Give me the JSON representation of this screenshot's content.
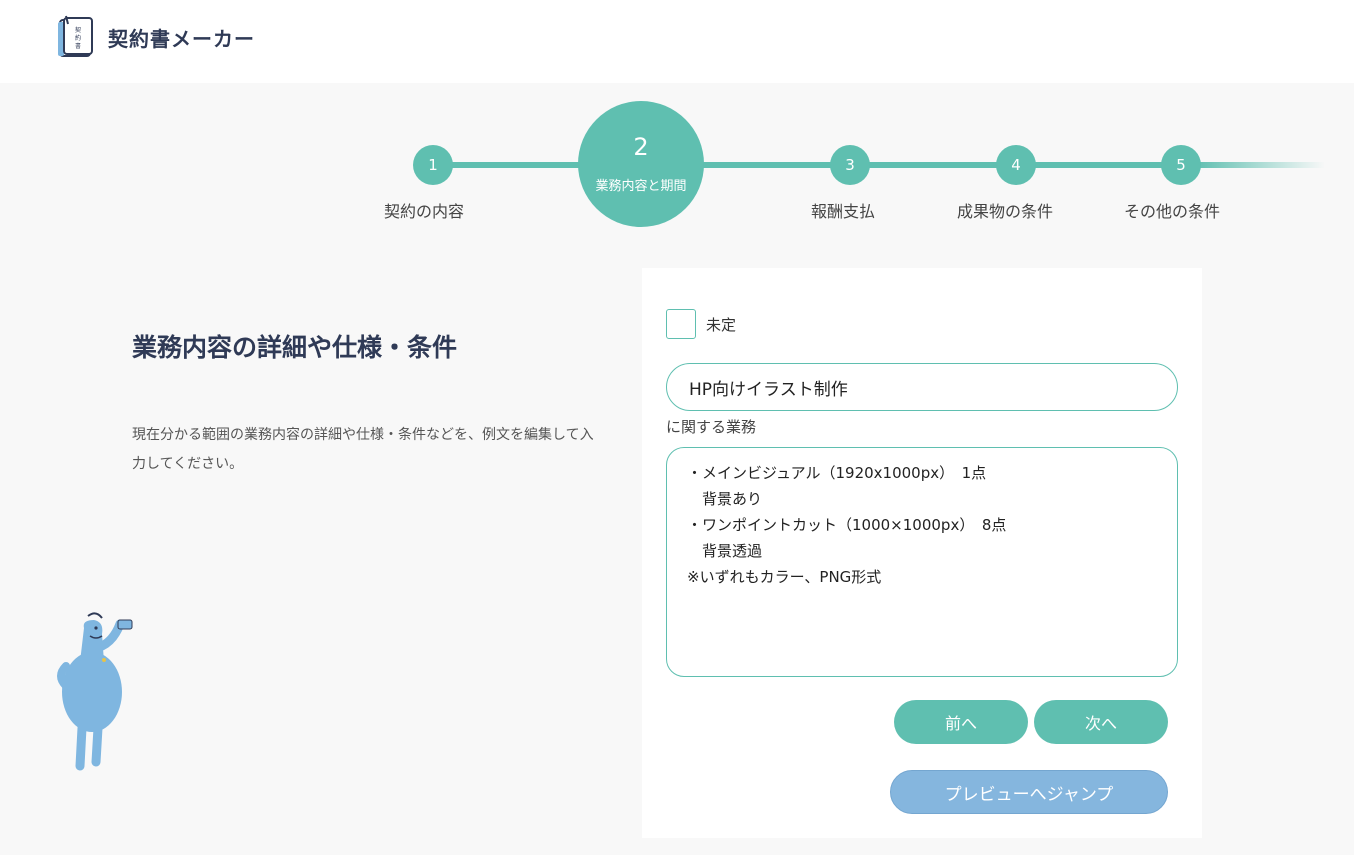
{
  "app": {
    "title": "契約書メーカー",
    "logo_icon": "contract-book-icon",
    "logo_badge": "契約書"
  },
  "stepper": {
    "active_index": 2,
    "steps": [
      {
        "number": "1",
        "label": "契約の内容"
      },
      {
        "number": "2",
        "label": "業務内容と期間"
      },
      {
        "number": "3",
        "label": "報酬支払"
      },
      {
        "number": "4",
        "label": "成果物の条件"
      },
      {
        "number": "5",
        "label": "その他の条件"
      }
    ]
  },
  "section": {
    "title": "業務内容の詳細や仕様・条件",
    "description": "現在分かる範囲の業務内容の詳細や仕様・条件などを、例文を編集して入力してください。"
  },
  "form": {
    "undecided_checkbox": {
      "label": "未定",
      "checked": false
    },
    "subject_input": {
      "value": "HP向けイラスト制作"
    },
    "subject_suffix": "に関する業務",
    "details": "・メインビジュアル（1920x1000px）　1点\n　背景あり\n・ワンポイントカット（1000×1000px）　8点\n　背景透過\n※いずれもカラー、PNG形式",
    "buttons": {
      "prev": "前へ",
      "next": "次へ",
      "preview": "プレビューへジャンプ"
    }
  },
  "colors": {
    "accent": "#5fbfb0",
    "preview_button": "#85b6de",
    "title_text": "#2f3a56",
    "background": "#f8f8f8"
  }
}
